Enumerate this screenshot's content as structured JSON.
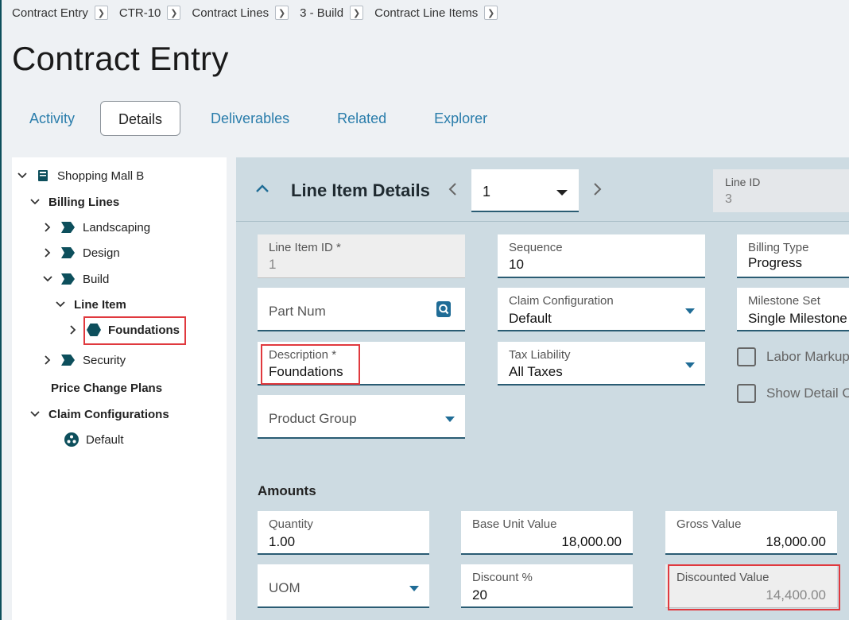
{
  "breadcrumb": [
    {
      "label": "Contract Entry"
    },
    {
      "label": "CTR-10"
    },
    {
      "label": "Contract Lines"
    },
    {
      "label": "3 - Build"
    },
    {
      "label": "Contract Line Items"
    }
  ],
  "page_title": "Contract Entry",
  "tabs": [
    {
      "label": "Activity",
      "active": false
    },
    {
      "label": "Details",
      "active": true
    },
    {
      "label": "Deliverables",
      "active": false
    },
    {
      "label": "Related",
      "active": false
    },
    {
      "label": "Explorer",
      "active": false
    }
  ],
  "tree": {
    "root": "Shopping Mall B",
    "billing_lines": "Billing Lines",
    "landscaping": "Landscaping",
    "design": "Design",
    "build": "Build",
    "line_item": "Line Item",
    "foundations": "Foundations",
    "security": "Security",
    "price_change_plans": "Price Change Plans",
    "claim_configurations": "Claim Configurations",
    "default": "Default"
  },
  "panel": {
    "title": "Line Item Details",
    "page_value": "1",
    "line_id_label": "Line ID",
    "line_id_value": "3"
  },
  "fields": {
    "line_item_id": {
      "label": "Line Item ID *",
      "value": "1"
    },
    "sequence": {
      "label": "Sequence",
      "value": "10"
    },
    "billing_type": {
      "label": "Billing Type",
      "value": "Progress"
    },
    "part_num": {
      "label": "Part Num"
    },
    "claim_configuration": {
      "label": "Claim Configuration",
      "value": "Default"
    },
    "milestone_set": {
      "label": "Milestone Set",
      "value": "Single Milestone"
    },
    "description": {
      "label": "Description *",
      "value": "Foundations"
    },
    "tax_liability": {
      "label": "Tax Liability",
      "value": "All Taxes"
    },
    "labor_markup": {
      "label": "Labor Markup"
    },
    "show_detail": {
      "label": "Show Detail C"
    },
    "product_group": {
      "label": "Product Group"
    }
  },
  "amounts": {
    "title": "Amounts",
    "quantity": {
      "label": "Quantity",
      "value": "1.00"
    },
    "base_unit_value": {
      "label": "Base Unit Value",
      "value": "18,000.00"
    },
    "gross_value": {
      "label": "Gross Value",
      "value": "18,000.00"
    },
    "uom": {
      "label": "UOM"
    },
    "discount_pct": {
      "label": "Discount %",
      "value": "20"
    },
    "discounted_value": {
      "label": "Discounted Value",
      "value": "14,400.00"
    }
  },
  "colors": {
    "accent": "#2a7dab",
    "tree_icon": "#0d4f5c",
    "highlight": "#e0393e",
    "panel_bg": "#cddbe2"
  }
}
